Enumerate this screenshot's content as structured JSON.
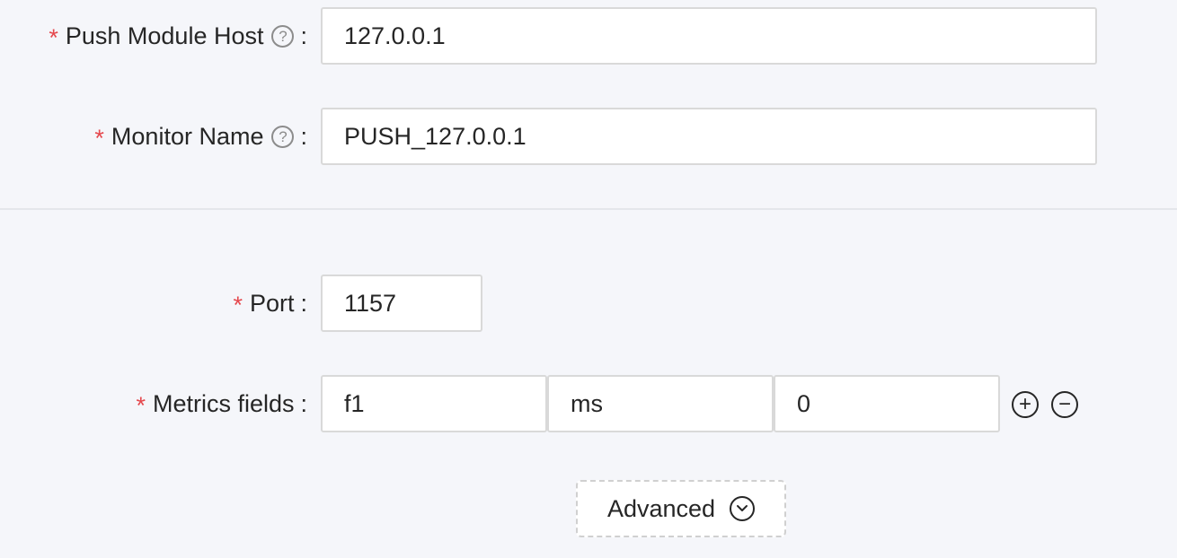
{
  "form": {
    "push_host": {
      "required_mark": "*",
      "label": "Push Module Host",
      "help": "?",
      "colon": ":",
      "value": "127.0.0.1"
    },
    "monitor_name": {
      "required_mark": "*",
      "label": "Monitor Name",
      "help": "?",
      "colon": ":",
      "value": "PUSH_127.0.0.1"
    },
    "port": {
      "required_mark": "*",
      "label": "Port",
      "colon": ":",
      "value": "1157"
    },
    "metrics_fields": {
      "required_mark": "*",
      "label": "Metrics fields",
      "colon": ":",
      "field_name": "f1",
      "unit": "ms",
      "type": "0",
      "add_icon": "plus-circle-icon",
      "remove_icon": "minus-circle-icon",
      "add_glyph": "+",
      "remove_glyph": "−"
    },
    "advanced": {
      "label": "Advanced",
      "icon": "chevron-down-circle-icon"
    }
  },
  "colors": {
    "required": "#e5484d",
    "background": "#f5f6fa",
    "input_border": "#d9d9d9"
  }
}
